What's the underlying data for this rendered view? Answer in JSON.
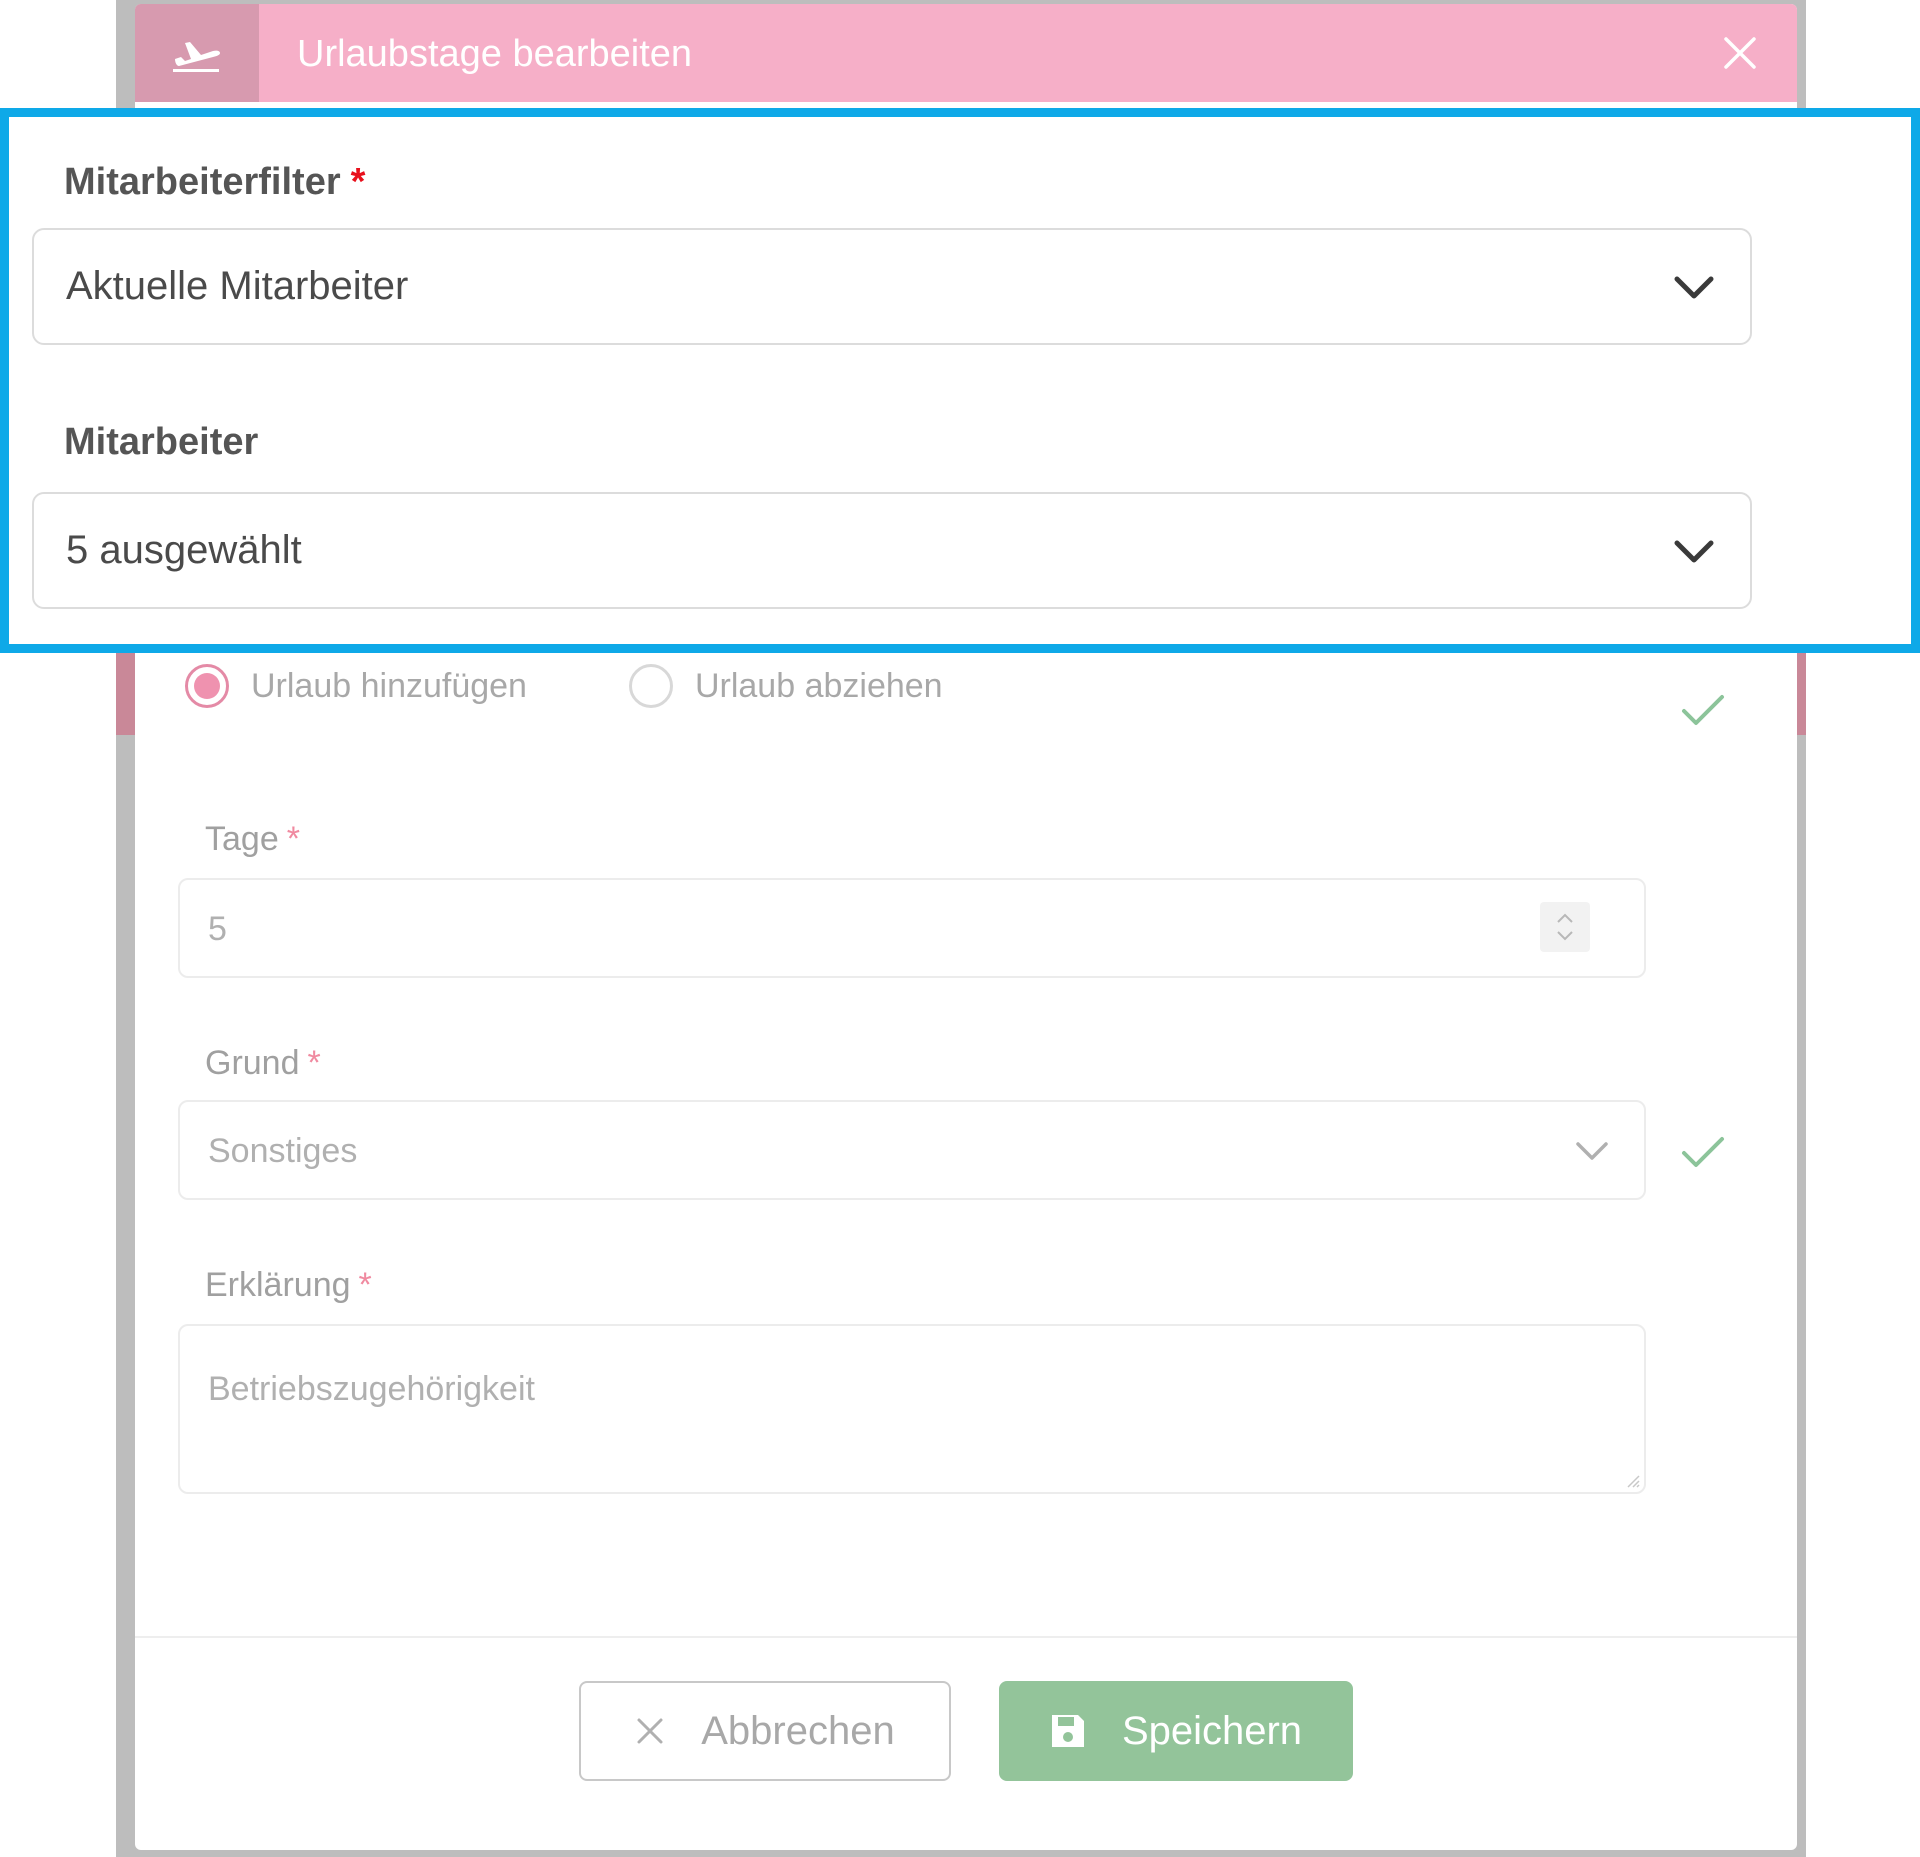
{
  "modal": {
    "title": "Urlaubstage bearbeiten",
    "header_icon": "airplane-departure-icon",
    "close_icon": "close-icon",
    "header_color": "#f6afc8"
  },
  "highlight": {
    "border_color": "#0ea9e8",
    "employee_filter": {
      "label": "Mitarbeiterfilter",
      "required_mark": "*",
      "value": "Aktuelle Mitarbeiter"
    },
    "employees": {
      "label": "Mitarbeiter",
      "value": "5 ausgewählt"
    }
  },
  "form": {
    "radio_add": {
      "label": "Urlaub hinzufügen",
      "checked": true
    },
    "radio_subtract": {
      "label": "Urlaub abziehen",
      "checked": false
    },
    "days": {
      "label": "Tage",
      "required_mark": "*",
      "value": "5"
    },
    "reason": {
      "label": "Grund",
      "required_mark": "*",
      "value": "Sonstiges"
    },
    "explanation": {
      "label": "Erklärung",
      "required_mark": "*",
      "value": "Betriebszugehörigkeit"
    }
  },
  "footer": {
    "cancel_label": "Abbrechen",
    "save_label": "Speichern",
    "save_color": "#93c49a"
  }
}
